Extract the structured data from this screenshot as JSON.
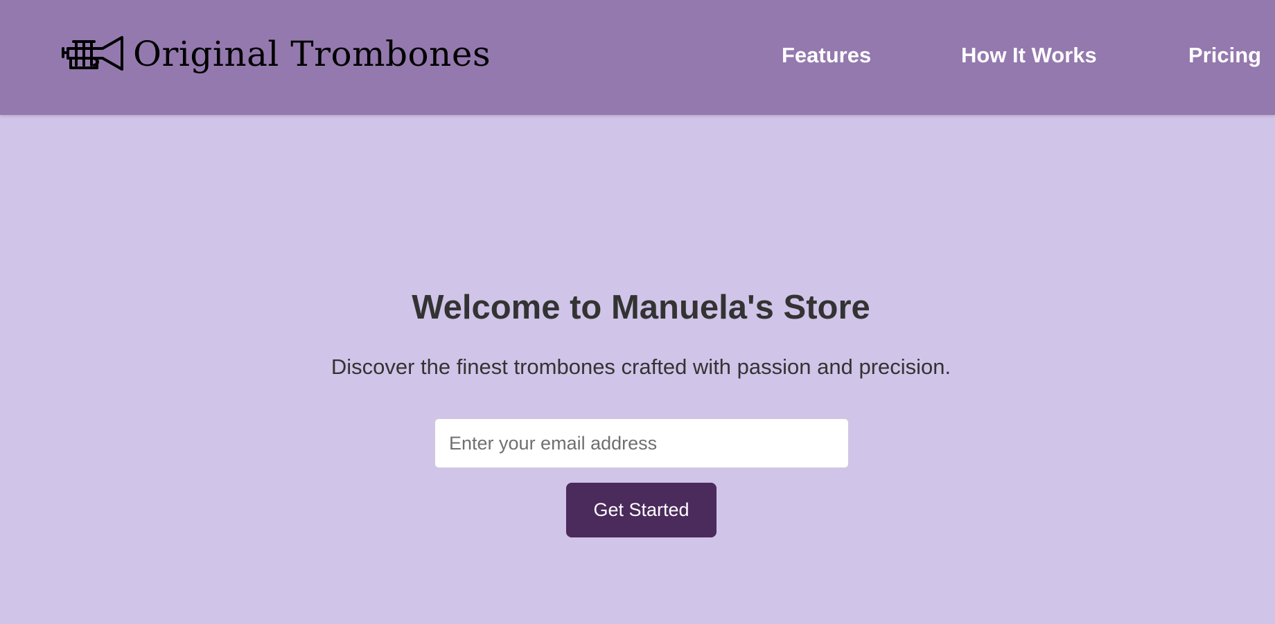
{
  "header": {
    "brand": "Original Trombones",
    "logo_icon": "trombone-icon",
    "nav": {
      "features": "Features",
      "how_it_works": "How It Works",
      "pricing": "Pricing"
    }
  },
  "hero": {
    "title": "Welcome to Manuela's Store",
    "subtitle": "Discover the finest trombones crafted with passion and precision.",
    "email_placeholder": "Enter your email address",
    "email_value": "",
    "cta_label": "Get Started"
  },
  "colors": {
    "header_bg": "#9479ae",
    "page_bg": "#d0c4e8",
    "button_bg": "#4b2a5c",
    "nav_text": "#ffffff",
    "heading_text": "#333333"
  }
}
